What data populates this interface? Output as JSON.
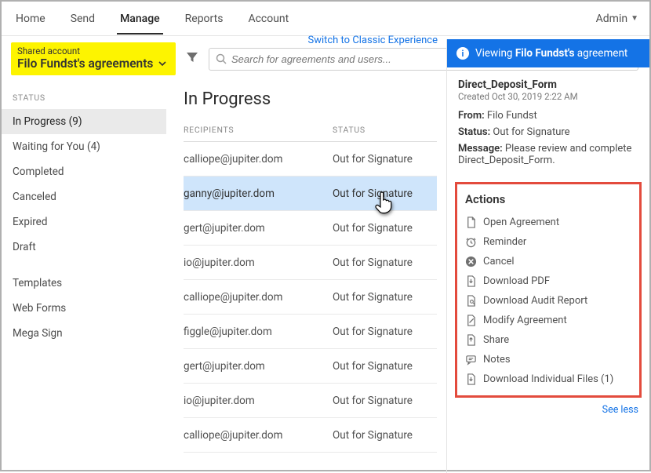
{
  "topnav": {
    "items": [
      {
        "label": "Home"
      },
      {
        "label": "Send"
      },
      {
        "label": "Manage"
      },
      {
        "label": "Reports"
      },
      {
        "label": "Account"
      }
    ],
    "user": "Admin"
  },
  "subheader": {
    "shared_label": "Shared account",
    "shared_name": "Filo Fundst's agreements",
    "classic_link": "Switch to Classic Experience",
    "search_placeholder": "Search for agreements and users..."
  },
  "sidebar": {
    "heading": "STATUS",
    "items": [
      {
        "label": "In Progress (9)"
      },
      {
        "label": "Waiting for You (4)"
      },
      {
        "label": "Completed"
      },
      {
        "label": "Canceled"
      },
      {
        "label": "Expired"
      },
      {
        "label": "Draft"
      }
    ],
    "extra": [
      {
        "label": "Templates"
      },
      {
        "label": "Web Forms"
      },
      {
        "label": "Mega Sign"
      }
    ]
  },
  "center": {
    "title": "In Progress",
    "col_recipients": "RECIPIENTS",
    "col_status": "STATUS",
    "rows": [
      {
        "recipient": "calliope@jupiter.dom",
        "status": "Out for Signature"
      },
      {
        "recipient": "ganny@jupiter.dom",
        "status": "Out for Signature"
      },
      {
        "recipient": "gert@jupiter.dom",
        "status": "Out for Signature"
      },
      {
        "recipient": "io@jupiter.dom",
        "status": "Out for Signature"
      },
      {
        "recipient": "calliope@jupiter.dom",
        "status": "Out for Signature"
      },
      {
        "recipient": "figgle@jupiter.dom",
        "status": "Out for Signature"
      },
      {
        "recipient": "gert@jupiter.dom",
        "status": "Out for Signature"
      },
      {
        "recipient": "io@jupiter.dom",
        "status": "Out for Signature"
      },
      {
        "recipient": "calliope@jupiter.dom",
        "status": "Out for Signature"
      }
    ]
  },
  "right": {
    "banner_prefix": "Viewing ",
    "banner_bold": "Filo Fundst's",
    "banner_suffix": " agreement",
    "doc_title": "Direct_Deposit_Form",
    "doc_created": "Created Oct 30, 2019 2:22 AM",
    "from_label": "From:",
    "from_value": "Filo Fundst",
    "status_label": "Status:",
    "status_value": "Out for Signature",
    "message_label": "Message:",
    "message_value": "Please review and complete Direct_Deposit_Form.",
    "actions_heading": "Actions",
    "actions": [
      {
        "label": "Open Agreement",
        "icon": "file"
      },
      {
        "label": "Reminder",
        "icon": "clock"
      },
      {
        "label": "Cancel",
        "icon": "cancel"
      },
      {
        "label": "Download PDF",
        "icon": "download"
      },
      {
        "label": "Download Audit Report",
        "icon": "audit"
      },
      {
        "label": "Modify Agreement",
        "icon": "edit"
      },
      {
        "label": "Share",
        "icon": "share"
      },
      {
        "label": "Notes",
        "icon": "notes"
      },
      {
        "label": "Download Individual Files (1)",
        "icon": "download"
      }
    ],
    "see_less": "See less"
  }
}
